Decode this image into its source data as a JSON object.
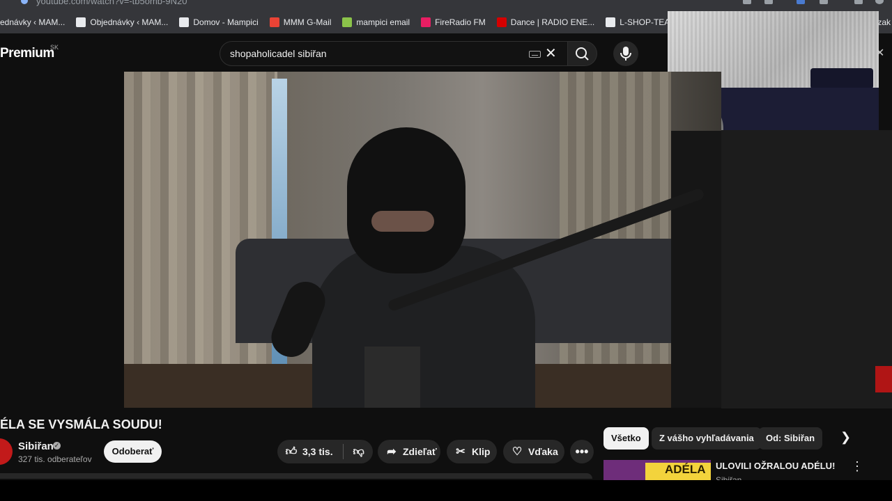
{
  "browser": {
    "url": "youtube.com/watch?v=-tb5omb-9N20",
    "bookmarks": [
      {
        "label": "ednávky ‹ MAM...",
        "icon": "wordpress-icon",
        "color": "#2a6fbf"
      },
      {
        "label": "Objednávky ‹ MAM...",
        "icon": "mampici-icon",
        "color": "#e8eaed"
      },
      {
        "label": "Domov - Mampici",
        "icon": "mampici-icon",
        "color": "#e8eaed"
      },
      {
        "label": "MMM G-Mail",
        "icon": "gmail-icon",
        "color": "#ea4335"
      },
      {
        "label": "mampici email",
        "icon": "email-icon",
        "color": "#8bc34a"
      },
      {
        "label": "FireRadio FM",
        "icon": "fireradio-icon",
        "color": "#e91e63"
      },
      {
        "label": "Dance | RADIO ENE...",
        "icon": "radio-energy-icon",
        "color": "#d50000"
      },
      {
        "label": "L-SHOP-TEAM Česko",
        "icon": "lshop-icon",
        "color": "#e8eaed"
      }
    ],
    "bookmarks_overflow": "y zak"
  },
  "header": {
    "logo": "Premium",
    "region": "SK",
    "search_value": "shopaholicadel sibiřan"
  },
  "video": {
    "title": "ÉLA SE VYSMÁLA SOUDU!",
    "channel": "Sibiřan",
    "subscribers": "327 tis. odberateľov",
    "subscribe_label": "Odoberať",
    "likes": "3,3 tis.",
    "share_label": "Zdieľať",
    "clip_label": "Klip",
    "thanks_label": "Vďaka"
  },
  "sidebar": {
    "chips": [
      "Všetko",
      "Z vášho vyhľadávania",
      "Od: Sibiřan"
    ],
    "active_chip": "Všetko",
    "recommendation": {
      "title": "ULOVILI OŽRALOU ADÉLU!",
      "channel": "Sibiřan",
      "thumb_text": "ADÉLA"
    }
  }
}
